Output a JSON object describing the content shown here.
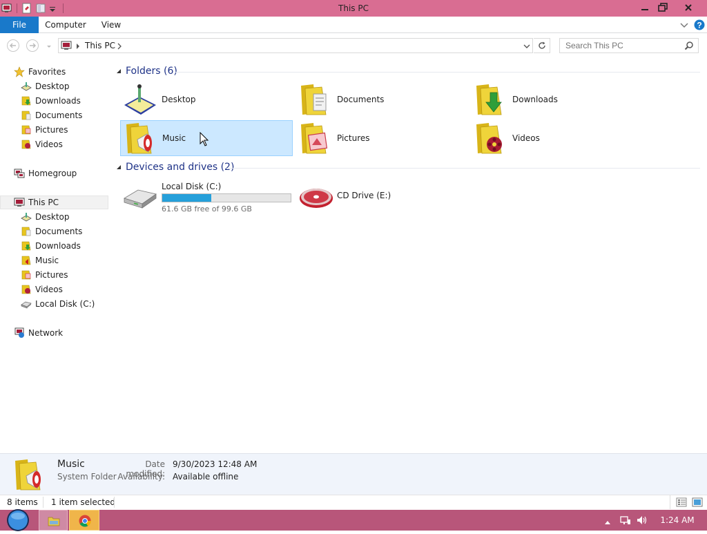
{
  "window": {
    "title": "This PC"
  },
  "ribbon": {
    "tabs": [
      "File",
      "Computer",
      "View"
    ]
  },
  "address": {
    "root": "This PC",
    "search_placeholder": "Search This PC"
  },
  "nav": {
    "favorites": {
      "label": "Favorites",
      "items": [
        "Desktop",
        "Downloads",
        "Documents",
        "Pictures",
        "Videos"
      ]
    },
    "homegroup": {
      "label": "Homegroup"
    },
    "thispc": {
      "label": "This PC",
      "items": [
        "Desktop",
        "Documents",
        "Downloads",
        "Music",
        "Pictures",
        "Videos",
        "Local Disk (C:)"
      ]
    },
    "network": {
      "label": "Network"
    }
  },
  "content": {
    "folders_header": "Folders (6)",
    "folders": [
      "Desktop",
      "Documents",
      "Downloads",
      "Music",
      "Pictures",
      "Videos"
    ],
    "devices_header": "Devices and drives (2)",
    "drive_c": {
      "name": "Local Disk (C:)",
      "free_text": "61.6 GB free of 99.6 GB",
      "used_fraction": 0.3815
    },
    "drive_e": {
      "name": "CD Drive (E:)"
    }
  },
  "details": {
    "name": "Music",
    "type": "System Folder",
    "date_label": "Date modified:",
    "date_value": "9/30/2023 12:48 AM",
    "avail_label": "Availability:",
    "avail_value": "Available offline"
  },
  "status": {
    "items": "8 items",
    "selected": "1 item selected"
  },
  "taskbar": {
    "clock": "1:24 AM"
  },
  "colors": {
    "accent": "#1979ca",
    "titlebar": "#d96d92",
    "taskbar": "#b8567a",
    "selection": "#cce8ff",
    "header_text": "#1e3287",
    "drive_bar": "#26a0da"
  }
}
